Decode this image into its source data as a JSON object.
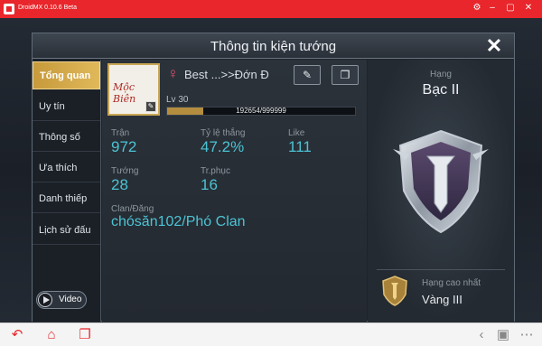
{
  "emulator": {
    "title": "DroidMX 0.10.6 Beta",
    "controls": [
      "gear-icon",
      "minimize-icon",
      "restore-icon",
      "close-icon"
    ]
  },
  "dialog": {
    "title": "Thông tin kiện tướng",
    "close_label": "✕"
  },
  "nav": {
    "items": [
      {
        "label": "Tổng quan",
        "active": true
      },
      {
        "label": "Uy tín",
        "active": false
      },
      {
        "label": "Thông số",
        "active": false
      },
      {
        "label": "Ưa thích",
        "active": false
      },
      {
        "label": "Danh thiếp",
        "active": false
      },
      {
        "label": "Lịch sử đấu",
        "active": false
      }
    ],
    "video_label": "Video"
  },
  "profile": {
    "gender_symbol": "♀",
    "name": "Best ...>>Đớn Đ",
    "avatar_text": "Mộc Biên",
    "level": "Lv 30",
    "xp_text": "192654/999999",
    "xp_fraction": 0.1927
  },
  "stats": {
    "matches_label": "Trận",
    "matches_value": "972",
    "winrate_label": "Tỷ lệ thắng",
    "winrate_value": "47.2%",
    "like_label": "Like",
    "like_value": "111",
    "heroes_label": "Tướng",
    "heroes_value": "28",
    "skins_label": "Tr.phục",
    "skins_value": "16",
    "clan_label": "Clan/Đăng",
    "clan_value": "chósăn102/Phó Clan"
  },
  "rank": {
    "label": "Hạng",
    "value": "Bạc II",
    "highest_label": "Hạng cao nhất",
    "highest_value": "Vàng III"
  },
  "colors": {
    "emulator_red": "#e8262b",
    "active_tab": "#c79a3b",
    "stat_value": "#4cc3d4"
  }
}
